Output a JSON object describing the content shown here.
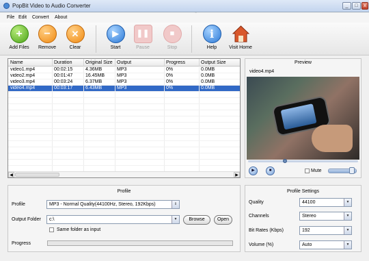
{
  "window": {
    "title": "PopBit Video to Audio Converter",
    "min": "_",
    "max": "□",
    "close": "x"
  },
  "menu": [
    "File",
    "Edit",
    "Convert",
    "About"
  ],
  "toolbar": [
    {
      "label": "Add Files",
      "icon": "add-icon",
      "enabled": true
    },
    {
      "label": "Remove",
      "icon": "remove-icon",
      "enabled": true
    },
    {
      "label": "Clear",
      "icon": "clear-icon",
      "enabled": true
    },
    {
      "label": "Start",
      "icon": "play-icon",
      "enabled": true
    },
    {
      "label": "Pause",
      "icon": "pause-icon",
      "enabled": false
    },
    {
      "label": "Stop",
      "icon": "stop-icon",
      "enabled": false
    },
    {
      "label": "Help",
      "icon": "info-icon",
      "enabled": true
    },
    {
      "label": "Visit Home",
      "icon": "home-icon",
      "enabled": true
    }
  ],
  "filelist": {
    "columns": [
      "Name",
      "Duration",
      "Original Size",
      "Output",
      "Progress",
      "Output Size"
    ],
    "rows": [
      [
        "video1.mp4",
        "00:02:15",
        "4.36MB",
        "MP3",
        "0%",
        "0.0MB"
      ],
      [
        "video2.mp4",
        "00:01:47",
        "16.45MB",
        "MP3",
        "0%",
        "0.0MB"
      ],
      [
        "video3.mp4",
        "00:03:24",
        "6.37MB",
        "MP3",
        "0%",
        "0.0MB"
      ],
      [
        "video4.mp4",
        "00:03:17",
        "6.43MB",
        "MP3",
        "0%",
        "0.0MB"
      ]
    ],
    "selected_index": 3
  },
  "preview": {
    "title": "Preview",
    "video_name": "video4.mp4",
    "mute_label": "Mute",
    "seek_progress": 0.34,
    "volume": 0.85
  },
  "profile": {
    "title": "Profile",
    "profile_label": "Profile",
    "profile_value": "MP3 - Normal Quality(44100Hz, Stereo, 192Kbps)",
    "output_label": "Output Folder",
    "output_value": "c:\\",
    "browse": "Browse",
    "open": "Open",
    "same_folder": "Same folder as input",
    "progress_label": "Progress",
    "progress": 0
  },
  "settings": {
    "title": "Profile Settings",
    "items": [
      {
        "label": "Quality",
        "value": "44100"
      },
      {
        "label": "Channels",
        "value": "Stereo"
      },
      {
        "label": "Bit Rates (Kbps)",
        "value": "192"
      },
      {
        "label": "Volume (%)",
        "value": "Auto"
      }
    ]
  }
}
